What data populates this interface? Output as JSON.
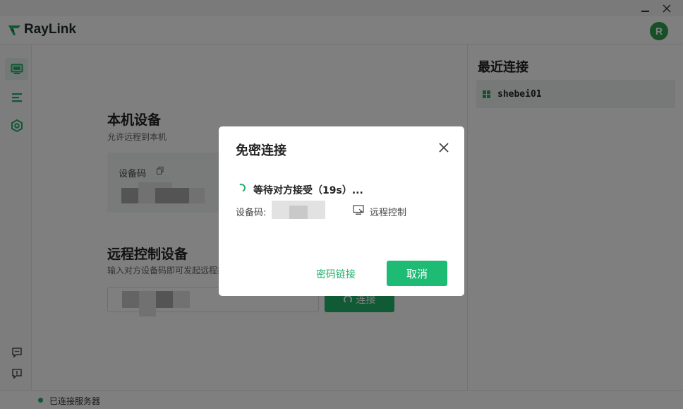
{
  "app": {
    "name": "RayLink",
    "brand_color": "#22b06a"
  },
  "window": {
    "minimize_icon": "minimize-icon",
    "close_icon": "close-icon"
  },
  "header": {
    "avatar_letter": "R"
  },
  "sidebar": {
    "items": [
      {
        "icon": "monitor-icon",
        "active": true
      },
      {
        "icon": "list-icon",
        "active": false
      },
      {
        "icon": "settings-icon",
        "active": false
      }
    ],
    "bottom_items": [
      {
        "icon": "chat-icon"
      },
      {
        "icon": "feedback-icon"
      },
      {
        "icon": "compass-icon"
      }
    ]
  },
  "main": {
    "local_device": {
      "title": "本机设备",
      "subtitle": "允许远程到本机",
      "code_label": "设备码"
    },
    "remote_control": {
      "title": "远程控制设备",
      "subtitle": "输入对方设备码即可发起远程控",
      "connect_label": "连接"
    }
  },
  "recent": {
    "title": "最近连接",
    "items": [
      {
        "name": "shebei01",
        "os_icon": "windows-icon"
      }
    ]
  },
  "status": {
    "text": "已连接服务器",
    "color": "#22b06a"
  },
  "modal": {
    "title": "免密连接",
    "waiting_text": "等待对方接受（19s）...",
    "code_label": "设备码: ",
    "mode_label": "远程控制",
    "password_link": "密码链接",
    "cancel_label": "取消"
  }
}
